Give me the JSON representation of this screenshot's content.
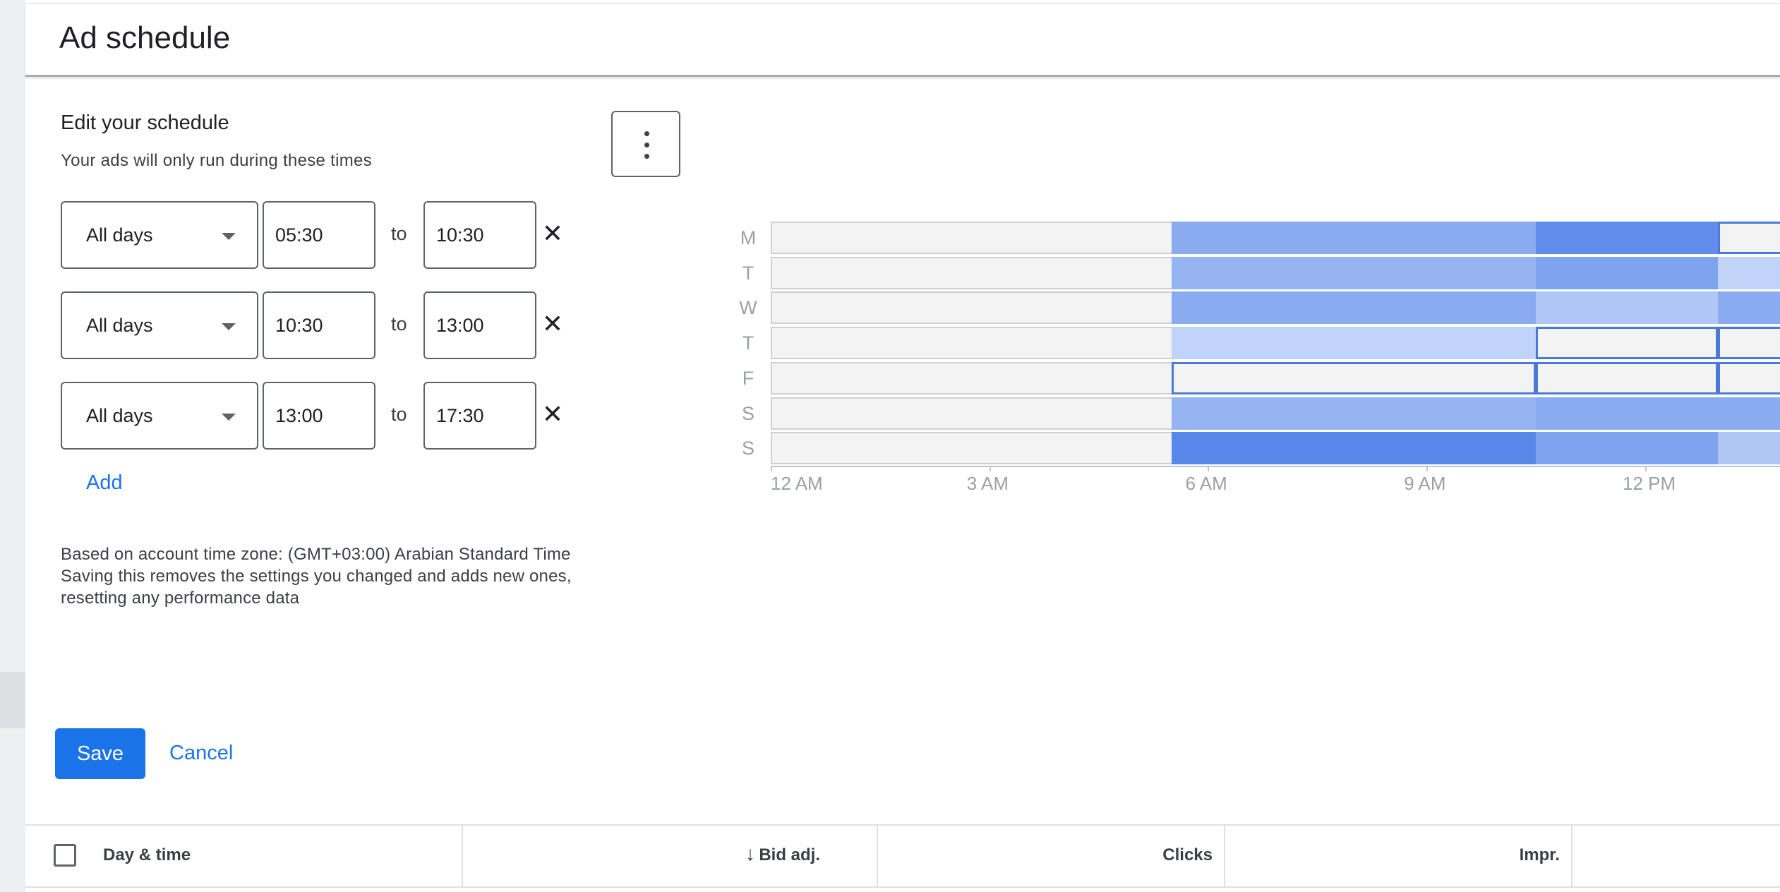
{
  "page": {
    "title": "Ad schedule"
  },
  "editor": {
    "title": "Edit your schedule",
    "subtitle": "Your ads will only run during these times",
    "more_icon": "more-vert-icon",
    "rows": [
      {
        "days": "All days",
        "start": "05:30",
        "to": "to",
        "end": "10:30"
      },
      {
        "days": "All days",
        "start": "10:30",
        "to": "to",
        "end": "13:00"
      },
      {
        "days": "All days",
        "start": "13:00",
        "to": "to",
        "end": "17:30"
      }
    ],
    "remove_glyph": "✕",
    "add_label": "Add",
    "timezone_line": "Based on account time zone: (GMT+03:00) Arabian Standard Time",
    "warning_line1": "Saving this removes the settings you changed and adds new ones,",
    "warning_line2": "resetting any performance data"
  },
  "heatmap": {
    "days": [
      "M",
      "T",
      "W",
      "T",
      "F",
      "S",
      "S"
    ],
    "tick_labels": [
      "12 AM",
      "3 AM",
      "6 AM",
      "9 AM",
      "12 PM"
    ],
    "tick_hours": [
      0,
      3,
      6,
      9,
      12
    ],
    "visible_hour_range": [
      0,
      13.85
    ],
    "segment_hours": [
      [
        5.5,
        10.5
      ],
      [
        10.5,
        13
      ],
      [
        13,
        17.5
      ]
    ],
    "colors": {
      "empty": "#f3f3f3",
      "outline": "#4a7ad9",
      "levels": [
        "#c2d3f9",
        "#b0c7f6",
        "#96b4f2",
        "#8aabf0",
        "#7ea3ef",
        "#6e95ec",
        "#628ceb",
        "#5887ea"
      ]
    },
    "cells": [
      [
        "#8aabf0",
        "#628ceb",
        "outline"
      ],
      [
        "#96b4f2",
        "#7ea3ef",
        "#c2d3f9"
      ],
      [
        "#8aabf0",
        "#b0c7f6",
        "#8aabf0"
      ],
      [
        "#c2d3f9",
        "outline",
        "outline"
      ],
      [
        "outline",
        "outline",
        "outline"
      ],
      [
        "#96b4f2",
        "#8aabf0",
        "#8aabf0"
      ],
      [
        "#5887ea",
        "#7ea3ef",
        "#b0c7f6"
      ]
    ]
  },
  "actions": {
    "save": "Save",
    "cancel": "Cancel"
  },
  "table": {
    "columns": [
      "Day & time",
      "Bid adj.",
      "Clicks",
      "Impr."
    ],
    "sort_icon": "arrow-down-icon"
  }
}
